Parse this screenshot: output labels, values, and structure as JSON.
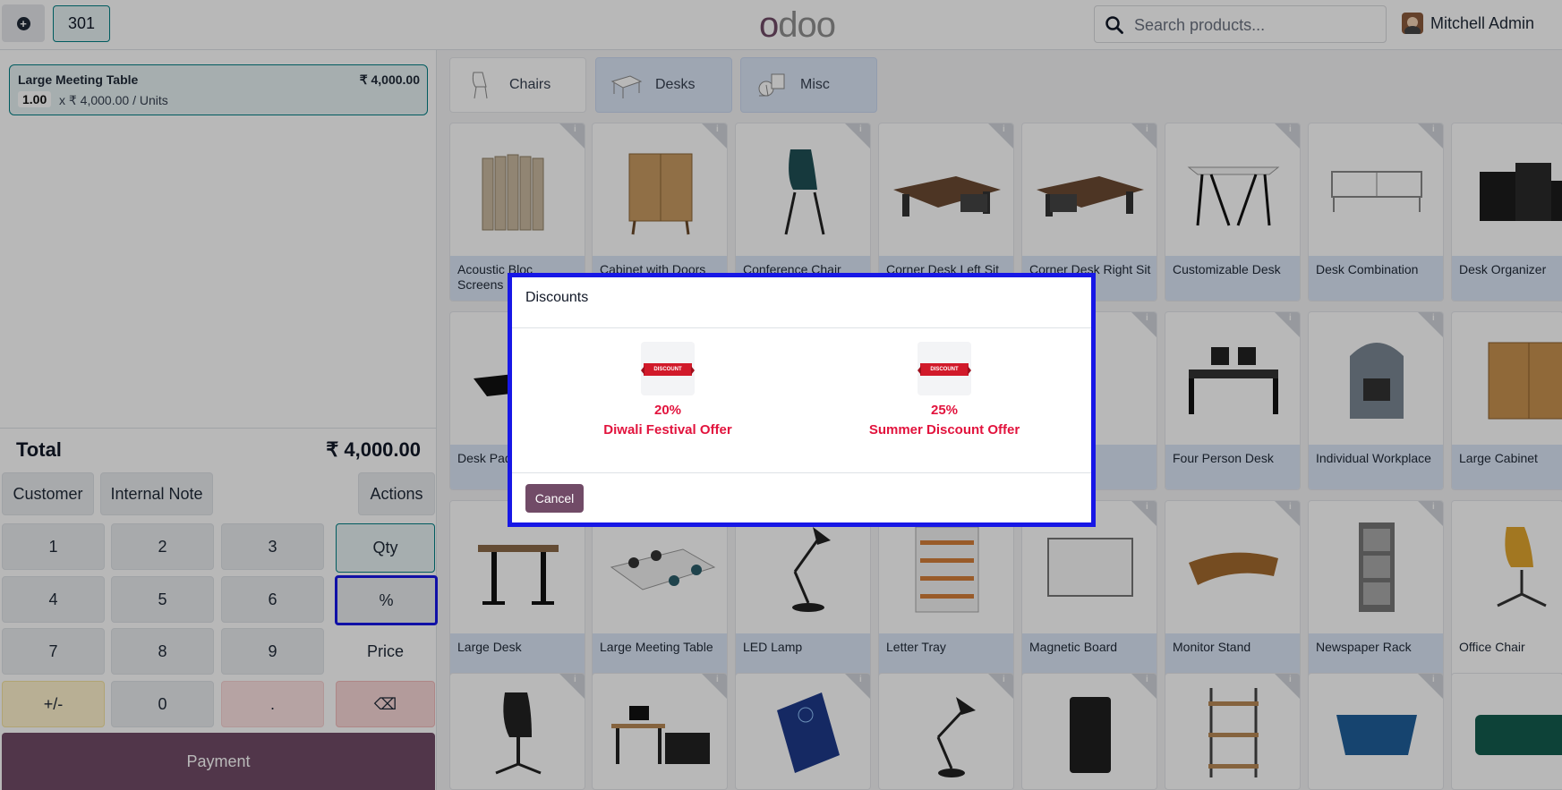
{
  "navbar": {
    "order_number": "301",
    "logo_first": "o",
    "logo_rest": "doo",
    "search_placeholder": "Search products...",
    "user_name": "Mitchell Admin"
  },
  "order": {
    "line": {
      "product": "Large Meeting Table",
      "price": "₹ 4,000.00",
      "qty": "1.00",
      "unit_text": "x ₹ 4,000.00 / Units"
    },
    "total_label": "Total",
    "total_value": "₹ 4,000.00"
  },
  "control_buttons": {
    "customer": "Customer",
    "internal_note": "Internal Note",
    "actions": "Actions"
  },
  "numpad": {
    "k1": "1",
    "k2": "2",
    "k3": "3",
    "qty": "Qty",
    "k4": "4",
    "k5": "5",
    "k6": "6",
    "pct": "%",
    "k7": "7",
    "k8": "8",
    "k9": "9",
    "price": "Price",
    "sign": "+/-",
    "k0": "0",
    "dot": ".",
    "back": "⌫"
  },
  "payment_label": "Payment",
  "categories": [
    {
      "label": "Chairs",
      "icon": "chair-icon"
    },
    {
      "label": "Desks",
      "icon": "desk-icon"
    },
    {
      "label": "Misc",
      "icon": "misc-icon"
    }
  ],
  "products": [
    "Acoustic Bloc Screens",
    "Cabinet with Doors",
    "Conference Chair",
    "Corner Desk Left Sit",
    "Corner Desk Right Sit",
    "Customizable Desk",
    "Desk Combination",
    "Desk Organizer",
    "Desk Pad",
    "",
    "",
    "",
    "",
    "Four Person Desk",
    "Individual Workplace",
    "Large Cabinet",
    "Large Desk",
    "Large Meeting Table",
    "LED Lamp",
    "Letter Tray",
    "Magnetic Board",
    "Monitor Stand",
    "Newspaper Rack",
    "Office Chair"
  ],
  "info_glyph": "i",
  "modal": {
    "title": "Discounts",
    "offers": [
      {
        "ribbon": "DISCOUNT",
        "percent": "20%",
        "name": "Diwali Festival Offer"
      },
      {
        "ribbon": "DISCOUNT",
        "percent": "25%",
        "name": "Summer Discount Offer"
      }
    ],
    "cancel_label": "Cancel"
  },
  "colors": {
    "brand": "#714b67",
    "teal": "#017e84",
    "highlight": "#1717e6",
    "offer_red": "#e2133d"
  }
}
